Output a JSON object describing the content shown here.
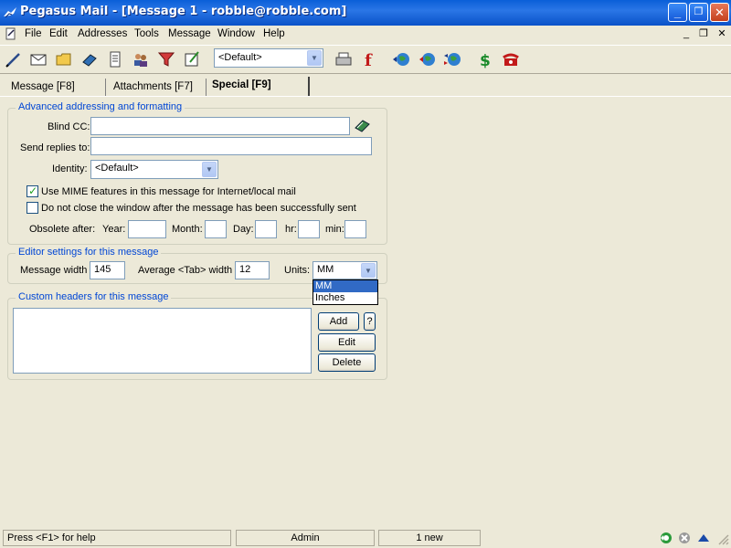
{
  "window": {
    "title": "Pegasus Mail - [Message 1 - robble@robble.com]",
    "minimize": "_",
    "restore": "❐",
    "close": "✕"
  },
  "menu": {
    "items": [
      "File",
      "Edit",
      "Addresses",
      "Tools",
      "Message",
      "Window",
      "Help"
    ],
    "mdi_minimize": "_",
    "mdi_restore": "❐",
    "mdi_close": "✕"
  },
  "toolbar": {
    "identity_value": "<Default>",
    "icons": [
      "new-message-icon",
      "read-mail-icon",
      "folders-icon",
      "addressbook-icon",
      "notepad-icon",
      "users-icon",
      "filter-icon",
      "edit-icon",
      "print-icon",
      "font-icon",
      "globe-send-icon",
      "globe-back-icon",
      "globe-sync-icon",
      "dollar-icon",
      "phone-icon"
    ]
  },
  "tabs": [
    {
      "label": "Message  [F8]",
      "active": false
    },
    {
      "label": "Attachments  [F7]",
      "active": false
    },
    {
      "label": "Special  [F9]",
      "active": true
    }
  ],
  "advanced": {
    "legend": "Advanced addressing and formatting",
    "blind_cc_label": "Blind CC:",
    "blind_cc_value": "",
    "replies_label": "Send replies to:",
    "replies_value": "",
    "identity_label": "Identity:",
    "identity_value": "<Default>",
    "mime_label": "Use MIME features in this message for Internet/local mail",
    "mime_checked": true,
    "noclose_label": "Do not close the window after the message has been successfully sent",
    "noclose_checked": false,
    "obsolete_label": "Obsolete after:",
    "year_label": "Year:",
    "month_label": "Month:",
    "day_label": "Day:",
    "hr_label": "hr:",
    "min_label": "min:"
  },
  "editor": {
    "legend": "Editor settings for this message",
    "width_label": "Message width",
    "width_value": "145",
    "tab_label": "Average <Tab> width",
    "tab_value": "12",
    "units_label": "Units:",
    "units_value": "MM",
    "units_options": [
      "MM",
      "Inches"
    ],
    "units_selected": "MM"
  },
  "custom": {
    "legend": "Custom headers for this message",
    "add": "Add",
    "help": "?",
    "edit": "Edit",
    "delete": "Delete"
  },
  "status": {
    "help": "Press <F1> for help",
    "user": "Admin",
    "new_count": "1 new"
  },
  "colors": {
    "titlebar": "#0a5fd8",
    "legend": "#0046d5",
    "selection": "#316ac5",
    "face": "#ece9d8"
  }
}
